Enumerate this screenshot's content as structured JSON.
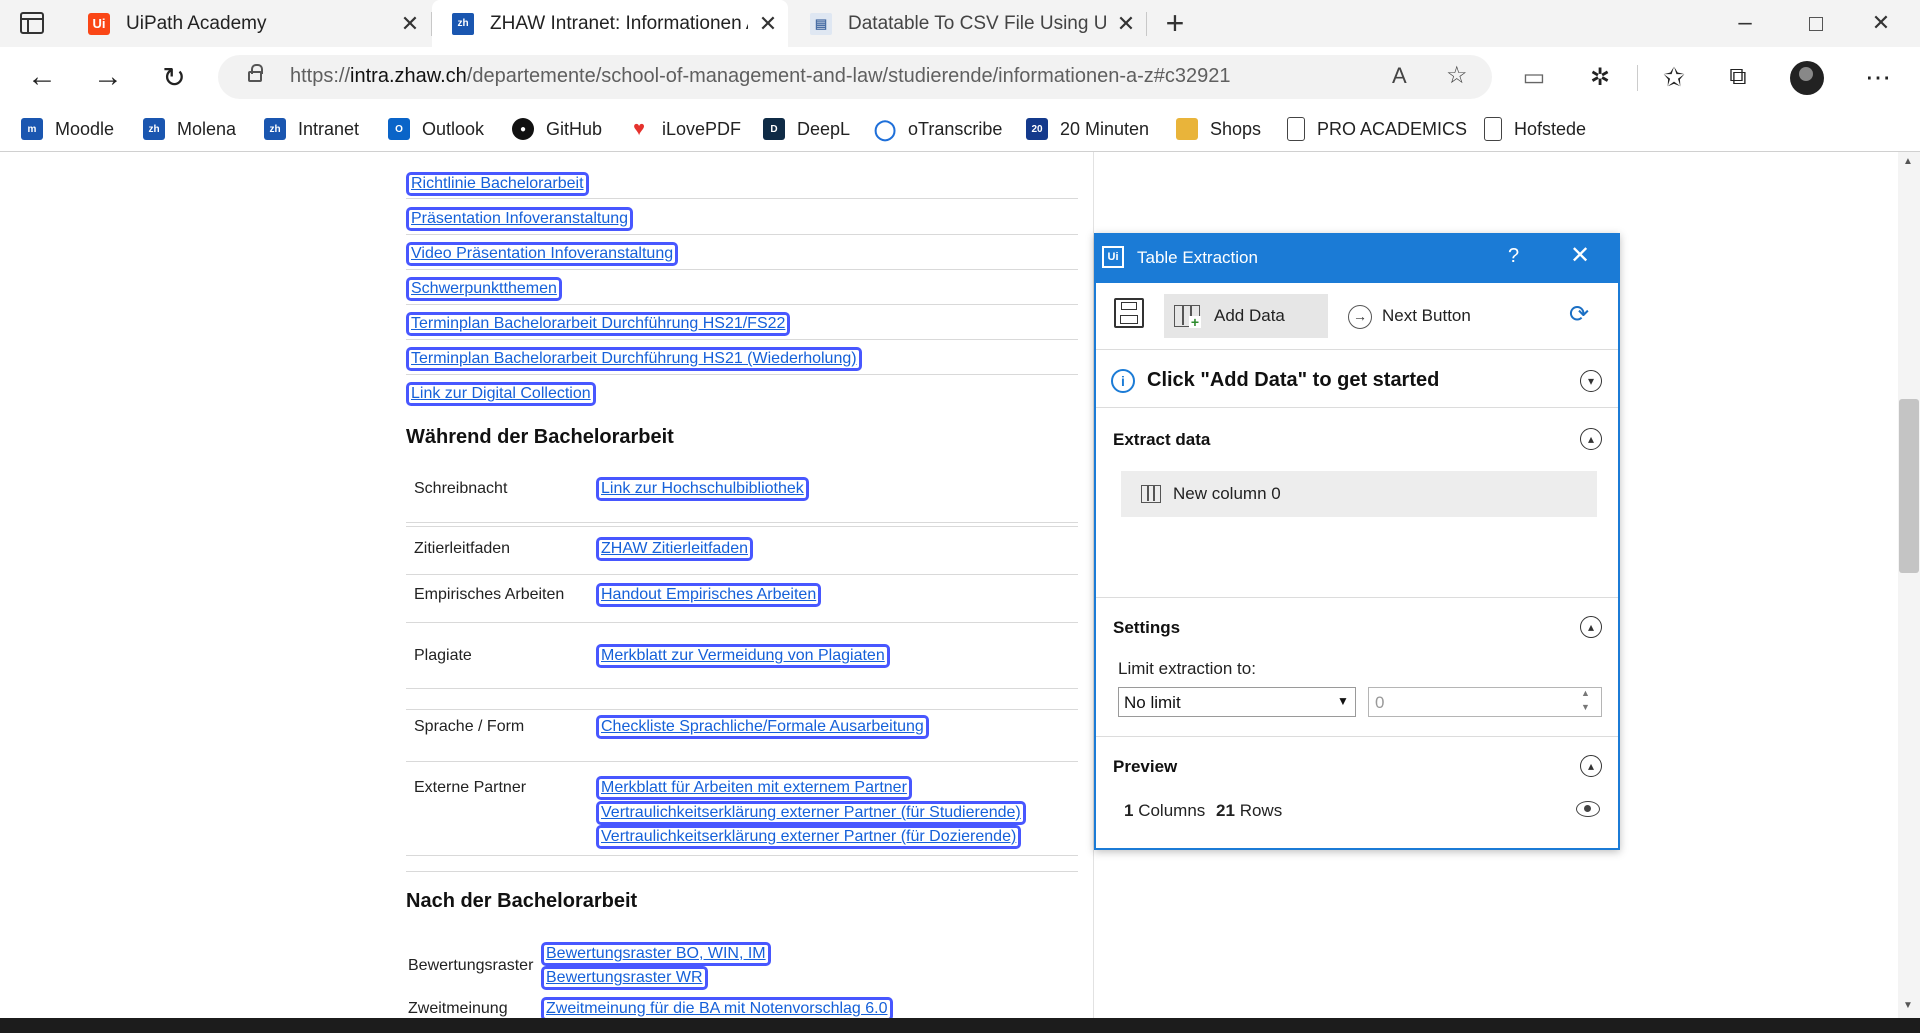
{
  "browser": {
    "tabs": [
      {
        "title": "UiPath Academy",
        "icon": "uipath-icon",
        "active": false
      },
      {
        "title": "ZHAW Intranet: Informationen A",
        "icon": "zhaw-icon",
        "active": true
      },
      {
        "title": "Datatable To CSV File Using UiPa",
        "icon": "document-icon",
        "active": false
      }
    ],
    "url_prefix": "https://",
    "url_host": "intra.zhaw.ch",
    "url_path": "/departemente/school-of-management-and-law/studierende/informationen-a-z#c32921",
    "bookmarks": [
      {
        "label": "Moodle",
        "icon": "moodle-icon",
        "color": "#1a56b0"
      },
      {
        "label": "Molena",
        "icon": "zhaw-icon",
        "color": "#1a56b0"
      },
      {
        "label": "Intranet",
        "icon": "zhaw-icon",
        "color": "#1a56b0"
      },
      {
        "label": "Outlook",
        "icon": "outlook-icon",
        "color": "#0a64c8"
      },
      {
        "label": "GitHub",
        "icon": "github-icon",
        "color": "#111111"
      },
      {
        "label": "iLovePDF",
        "icon": "heart-icon",
        "color": "#e5322d"
      },
      {
        "label": "DeepL",
        "icon": "deepl-icon",
        "color": "#0f2b46"
      },
      {
        "label": "oTranscribe",
        "icon": "otranscribe-icon",
        "color": "#1e6fd9"
      },
      {
        "label": "20 Minuten",
        "icon": "news-icon",
        "color": "#143a8c"
      },
      {
        "label": "Shops",
        "icon": "folder-icon",
        "color": "#e9b43a"
      },
      {
        "label": "PRO ACADEMICS",
        "icon": "page-icon",
        "color": "#444444"
      },
      {
        "label": "Hofstede",
        "icon": "page-icon",
        "color": "#444444"
      }
    ]
  },
  "page": {
    "top_links": [
      "Richtlinie Bachelorarbeit",
      "Präsentation Infoveranstaltung",
      "Video Präsentation Infoveranstaltung",
      "Schwerpunktthemen",
      "Terminplan Bachelorarbeit Durchführung HS21/FS22",
      "Terminplan Bachelorarbeit Durchführung HS21 (Wiederholung)",
      "Link zur Digital Collection"
    ],
    "during_heading": "Während der Bachelorarbeit",
    "during_rows": [
      {
        "label": "Schreibnacht",
        "links": [
          "Link zur Hochschulbibliothek"
        ]
      },
      {
        "label": "Zitierleitfaden",
        "links": [
          "ZHAW Zitierleitfaden"
        ]
      },
      {
        "label": "Empirisches Arbeiten",
        "links": [
          "Handout Empirisches Arbeiten"
        ]
      },
      {
        "label": "Plagiate",
        "links": [
          "Merkblatt zur Vermeidung von Plagiaten"
        ]
      },
      {
        "label": "Sprache / Form",
        "links": [
          "Checkliste Sprachliche/Formale Ausarbeitung"
        ]
      },
      {
        "label": "Externe Partner",
        "links": [
          "Merkblatt für Arbeiten mit externem Partner",
          "Vertraulichkeitserklärung externer Partner (für Studierende)",
          "Vertraulichkeitserklärung externer Partner (für Dozierende)"
        ]
      }
    ],
    "after_heading": "Nach der Bachelorarbeit",
    "after_rows": [
      {
        "label": "Bewertungsraster",
        "links": [
          "Bewertungsraster BO, WIN, IM",
          "Bewertungsraster WR"
        ]
      },
      {
        "label": "Zweitmeinung",
        "links": [
          "Zweitmeinung für die BA mit Notenvorschlag 6.0"
        ]
      }
    ]
  },
  "dialog": {
    "title": "Table Extraction",
    "help": "?",
    "add_data": "Add Data",
    "next_button": "Next Button",
    "info": "Click \"Add Data\" to get started",
    "extract_title": "Extract data",
    "column": "New column 0",
    "settings_title": "Settings",
    "limit_label": "Limit extraction to:",
    "limit_select": "No limit",
    "limit_value": "0",
    "preview_title": "Preview",
    "columns_count": "1",
    "columns_label": "Columns",
    "rows_count": "21",
    "rows_label": "Rows",
    "accent": "#1b7bd6"
  }
}
